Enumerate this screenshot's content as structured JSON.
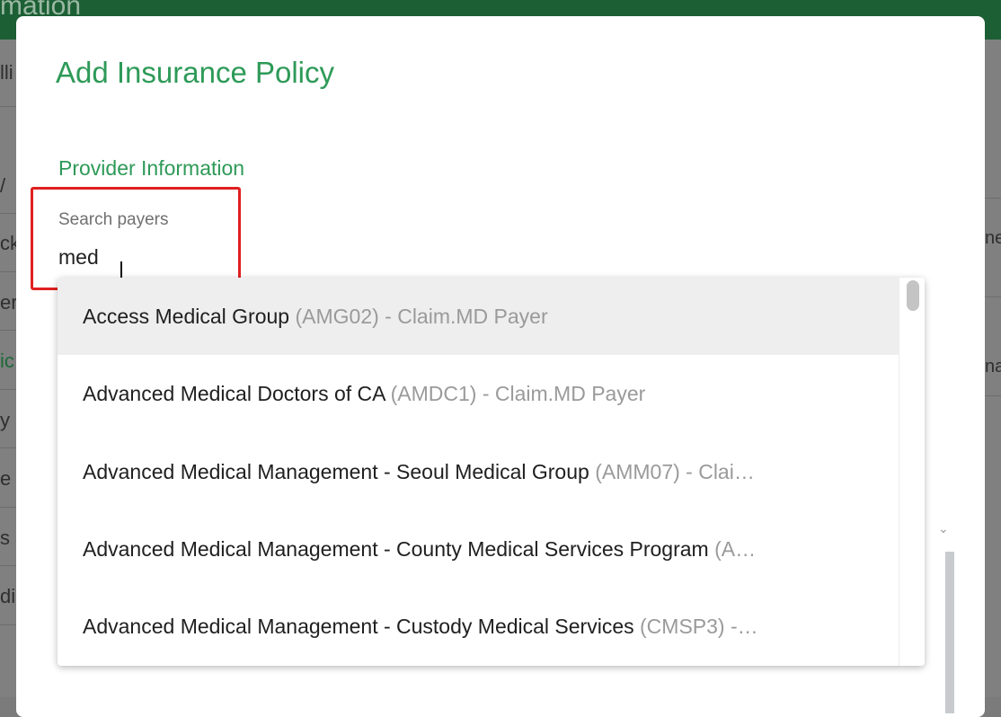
{
  "background": {
    "header_title": "mation",
    "left_items": [
      {
        "text": "lli",
        "active": false
      },
      {
        "text": "/",
        "active": false
      },
      {
        "text": "ck",
        "active": false
      },
      {
        "text": "er",
        "active": false
      },
      {
        "text": "ic",
        "active": true
      },
      {
        "text": "y",
        "active": false
      },
      {
        "text": "e",
        "active": false
      },
      {
        "text": "s &",
        "active": false
      },
      {
        "text": "di",
        "active": false
      }
    ],
    "right_items": [
      "ne",
      "na"
    ]
  },
  "modal": {
    "title": "Add Insurance Policy",
    "section_title": "Provider Information",
    "search": {
      "label": "Search payers",
      "value": "med"
    },
    "dropdown": {
      "options": [
        {
          "name": "Access Medical Group",
          "code": "(AMG02) - Claim.MD Payer",
          "highlighted": true
        },
        {
          "name": "Advanced Medical Doctors of CA",
          "code": "(AMDC1) - Claim.MD Payer",
          "highlighted": false
        },
        {
          "name": "Advanced Medical Management - Seoul Medical Group",
          "code": "(AMM07) - Clai…",
          "highlighted": false
        },
        {
          "name": "Advanced Medical Management - County Medical Services Program",
          "code": "(A…",
          "highlighted": false
        },
        {
          "name": "Advanced Medical Management - Custody Medical Services",
          "code": "(CMSP3) -…",
          "highlighted": false
        }
      ]
    }
  },
  "colors": {
    "accent_green": "#2e9a58",
    "header_green": "#1c5f35",
    "focus_outline": "#e02020",
    "highlight_bg": "#eeeeee"
  }
}
